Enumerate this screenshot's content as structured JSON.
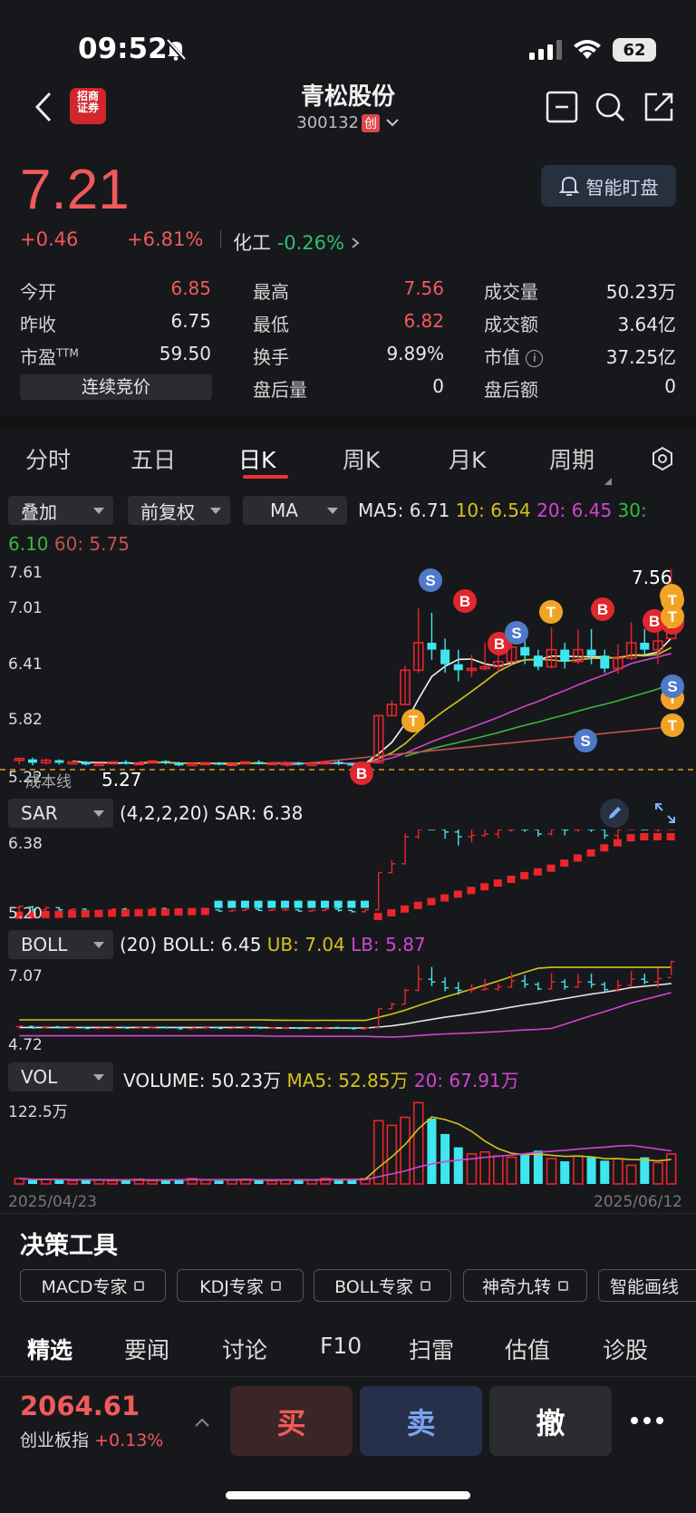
{
  "status": {
    "time": "09:52",
    "battery": "62"
  },
  "header": {
    "title": "青松股份",
    "code": "300132",
    "badge": "创",
    "logo_top": "招商",
    "logo_bottom": "证券"
  },
  "quote": {
    "price": "7.21",
    "change": "+0.46",
    "change_pct": "+6.81%",
    "industry": "化工",
    "industry_change": "-0.26%",
    "watch_button": "智能盯盘",
    "rows": [
      [
        {
          "label": "今开",
          "value": "6.85",
          "color": "red"
        },
        {
          "label": "最高",
          "value": "7.56",
          "color": "red"
        },
        {
          "label": "成交量",
          "value": "50.23万",
          "color": "white"
        }
      ],
      [
        {
          "label": "昨收",
          "value": "6.75",
          "color": "white"
        },
        {
          "label": "最低",
          "value": "6.82",
          "color": "red"
        },
        {
          "label": "成交额",
          "value": "3.64亿",
          "color": "white"
        }
      ],
      [
        {
          "label": "市盈TTM",
          "value": "59.50",
          "color": "white"
        },
        {
          "label": "换手",
          "value": "9.89%",
          "color": "white"
        },
        {
          "label": "市值",
          "value": "37.25亿",
          "color": "white"
        }
      ],
      [
        {
          "label": "",
          "value": "",
          "color": "white"
        },
        {
          "label": "盘后量",
          "value": "0",
          "color": "white"
        },
        {
          "label": "盘后额",
          "value": "0",
          "color": "white"
        }
      ]
    ],
    "auction_label": "连续竞价"
  },
  "tabs": [
    "分时",
    "五日",
    "日K",
    "周K",
    "月K",
    "周期"
  ],
  "active_tab": "日K",
  "main_chart": {
    "overlay": "叠加",
    "adjust": "前复权",
    "indicator": "MA",
    "ma5": "MA5: 6.71",
    "ma10": "10: 6.54",
    "ma20": "20: 6.45",
    "ma30": "30:",
    "ma30_val": "6.10",
    "ma60": "60: 5.75",
    "y_ticks": [
      "7.61",
      "7.01",
      "6.41",
      "5.82",
      "5.22"
    ],
    "high_label": "7.56",
    "low_label": "5.27",
    "waterline": "成本线"
  },
  "sar": {
    "name": "SAR",
    "params": "(4,2,2,20) SAR: 6.38",
    "y_top": "6.38",
    "y_bottom": "5.20"
  },
  "boll": {
    "name": "BOLL",
    "params": "(20) BOLL: 6.45",
    "ub": "UB: 7.04",
    "lb": "LB: 5.87",
    "y_top": "7.07",
    "y_bottom": "4.72"
  },
  "vol": {
    "name": "VOL",
    "params": "VOLUME: 50.23万",
    "ma5": "MA5: 52.85万",
    "ma20": "20: 67.91万",
    "y_top": "122.5万",
    "date_start": "2025/04/23",
    "date_end": "2025/06/12"
  },
  "tools": {
    "title": "决策工具",
    "items": [
      "MACD专家",
      "KDJ专家",
      "BOLL专家",
      "神奇九转",
      "智能画线"
    ]
  },
  "bottom_tabs": [
    "精选",
    "要闻",
    "讨论",
    "F10",
    "扫雷",
    "估值",
    "诊股"
  ],
  "index": {
    "value": "2064.61",
    "name": "创业板指",
    "change": "+0.13%"
  },
  "actions": {
    "buy": "买",
    "sell": "卖",
    "cancel": "撤"
  },
  "chart_data": {
    "type": "candlestick",
    "x_start": "2025/04/23",
    "x_end": "2025/06/12",
    "ylim": [
      5.22,
      7.61
    ],
    "candles": [
      [
        5.33,
        5.35,
        5.28,
        5.36
      ],
      [
        5.34,
        5.3,
        5.27,
        5.36
      ],
      [
        5.3,
        5.33,
        5.28,
        5.35
      ],
      [
        5.33,
        5.3,
        5.28,
        5.34
      ],
      [
        5.3,
        5.31,
        5.28,
        5.32
      ],
      [
        5.31,
        5.28,
        5.27,
        5.32
      ],
      [
        5.28,
        5.29,
        5.27,
        5.3
      ],
      [
        5.29,
        5.31,
        5.28,
        5.32
      ],
      [
        5.31,
        5.29,
        5.28,
        5.33
      ],
      [
        5.29,
        5.3,
        5.28,
        5.31
      ],
      [
        5.3,
        5.32,
        5.29,
        5.33
      ],
      [
        5.32,
        5.3,
        5.28,
        5.33
      ],
      [
        5.3,
        5.27,
        5.26,
        5.31
      ],
      [
        5.27,
        5.29,
        5.26,
        5.3
      ],
      [
        5.29,
        5.3,
        5.27,
        5.31
      ],
      [
        5.3,
        5.28,
        5.27,
        5.31
      ],
      [
        5.28,
        5.29,
        5.27,
        5.3
      ],
      [
        5.29,
        5.31,
        5.28,
        5.32
      ],
      [
        5.31,
        5.29,
        5.28,
        5.33
      ],
      [
        5.29,
        5.3,
        5.28,
        5.31
      ],
      [
        5.3,
        5.3,
        5.28,
        5.32
      ],
      [
        5.3,
        5.28,
        5.27,
        5.31
      ],
      [
        5.28,
        5.29,
        5.27,
        5.3
      ],
      [
        5.29,
        5.31,
        5.28,
        5.32
      ],
      [
        5.31,
        5.29,
        5.27,
        5.33
      ],
      [
        5.29,
        5.27,
        5.26,
        5.3
      ],
      [
        5.27,
        5.3,
        5.26,
        5.31
      ],
      [
        5.3,
        5.85,
        5.29,
        5.85
      ],
      [
        5.85,
        5.98,
        5.84,
        6.03
      ],
      [
        5.98,
        6.38,
        5.97,
        6.43
      ],
      [
        6.38,
        6.7,
        6.35,
        7.1
      ],
      [
        6.7,
        6.62,
        6.5,
        7.05
      ],
      [
        6.62,
        6.45,
        6.35,
        6.75
      ],
      [
        6.45,
        6.38,
        6.25,
        6.62
      ],
      [
        6.38,
        6.4,
        6.3,
        6.56
      ],
      [
        6.4,
        6.42,
        6.38,
        6.7
      ],
      [
        6.42,
        6.48,
        6.36,
        6.58
      ],
      [
        6.48,
        6.65,
        6.45,
        6.9
      ],
      [
        6.65,
        6.55,
        6.45,
        6.82
      ],
      [
        6.55,
        6.42,
        6.38,
        6.62
      ],
      [
        6.42,
        6.62,
        6.4,
        6.88
      ],
      [
        6.62,
        6.48,
        6.4,
        6.7
      ],
      [
        6.48,
        6.62,
        6.45,
        6.85
      ],
      [
        6.62,
        6.55,
        6.45,
        6.86
      ],
      [
        6.55,
        6.4,
        6.35,
        6.62
      ],
      [
        6.4,
        6.52,
        6.34,
        6.68
      ],
      [
        6.52,
        6.7,
        6.5,
        6.94
      ],
      [
        6.7,
        6.62,
        6.55,
        6.86
      ],
      [
        6.62,
        6.72,
        6.45,
        7.02
      ],
      [
        6.75,
        7.21,
        6.82,
        7.56
      ]
    ]
  }
}
